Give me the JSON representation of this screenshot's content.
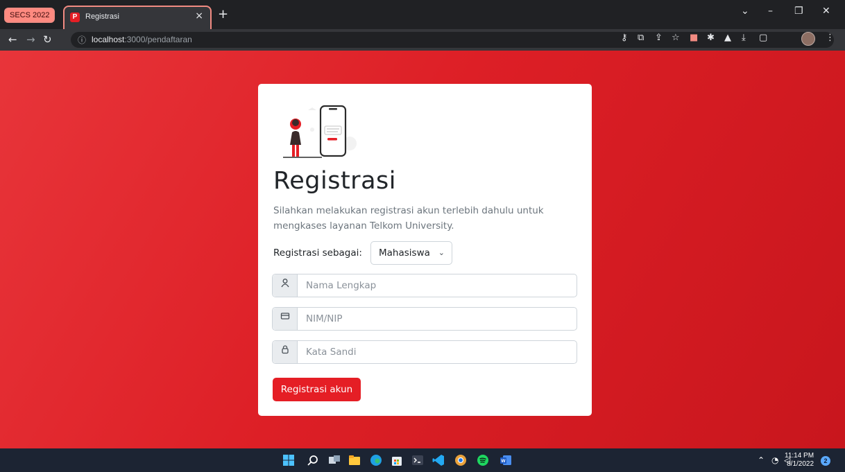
{
  "browser": {
    "tab_group_label": "SECS 2022",
    "active_tab_title": "Registrasi",
    "tab_close": "×",
    "new_tab": "+",
    "url_host": "localhost",
    "url_rest": ":3000/pendaftaran",
    "icons": [
      "back-icon",
      "forward-icon",
      "reload-icon",
      "info-icon",
      "key-icon",
      "translate-icon",
      "share-icon",
      "bookmark-star-icon",
      "extension-red-icon",
      "extensions-puzzle-icon",
      "labs-flask-icon",
      "download-icon",
      "side-panel-icon",
      "profile-avatar-icon",
      "menu-kebab-icon"
    ]
  },
  "page": {
    "title": "Registrasi",
    "description": "Silahkan melakukan registrasi akun terlebih dahulu untuk mengkases layanan Telkom University.",
    "role_label": "Registrasi sebagai:",
    "role_value": "Mahasiswa",
    "fields": {
      "name_placeholder": "Nama Lengkap",
      "nim_placeholder": "NIM/NIP",
      "password_placeholder": "Kata Sandi"
    },
    "submit_label": "Registrasi akun",
    "colors": {
      "brand_red": "#E51E25",
      "background_red": "#DD1F26"
    }
  },
  "taskbar": {
    "time": "11:14 PM",
    "date": "8/1/2022",
    "notification_count": "2",
    "apps": [
      "windows-start-icon",
      "search-icon",
      "task-view-icon",
      "file-explorer-icon",
      "edge-icon",
      "store-icon",
      "terminal-icon",
      "vscode-icon",
      "chrome-dev-icon",
      "spotify-icon",
      "word-icon"
    ]
  }
}
